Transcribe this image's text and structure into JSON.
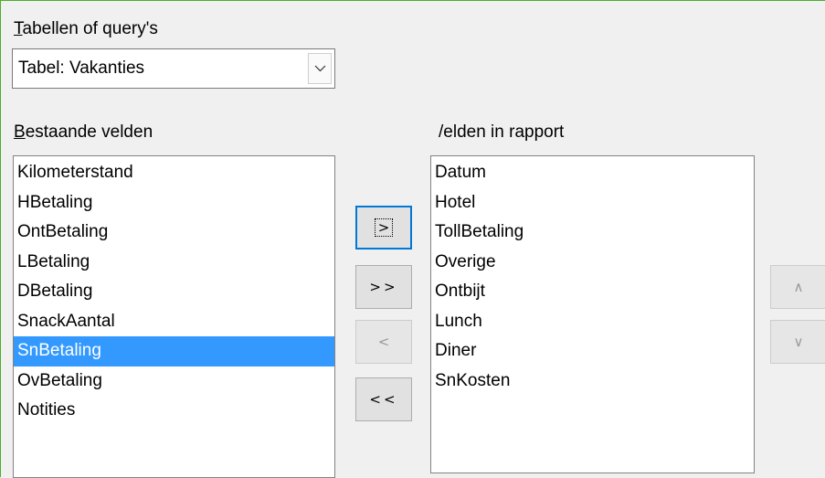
{
  "tables_label": "Tabellen of query's",
  "table_select": {
    "value": "Tabel: Vakanties"
  },
  "available_fields": {
    "label": "Bestaande velden",
    "items": [
      "Kilometerstand",
      "HBetaling",
      "OntBetaling",
      "LBetaling",
      "DBetaling",
      "SnackAantal",
      "SnBetaling",
      "OvBetaling",
      "Notities"
    ],
    "selected": "SnBetaling"
  },
  "report_fields": {
    "label": "/elden in rapport",
    "items": [
      "Datum",
      "Hotel",
      "TollBetaling",
      "Overige",
      "Ontbijt",
      "Lunch",
      "Diner",
      "SnKosten"
    ]
  },
  "buttons": {
    "add": ">",
    "add_all": ">>",
    "remove": "<",
    "remove_all": "<<",
    "move_up": "∧",
    "move_down": "∨"
  }
}
